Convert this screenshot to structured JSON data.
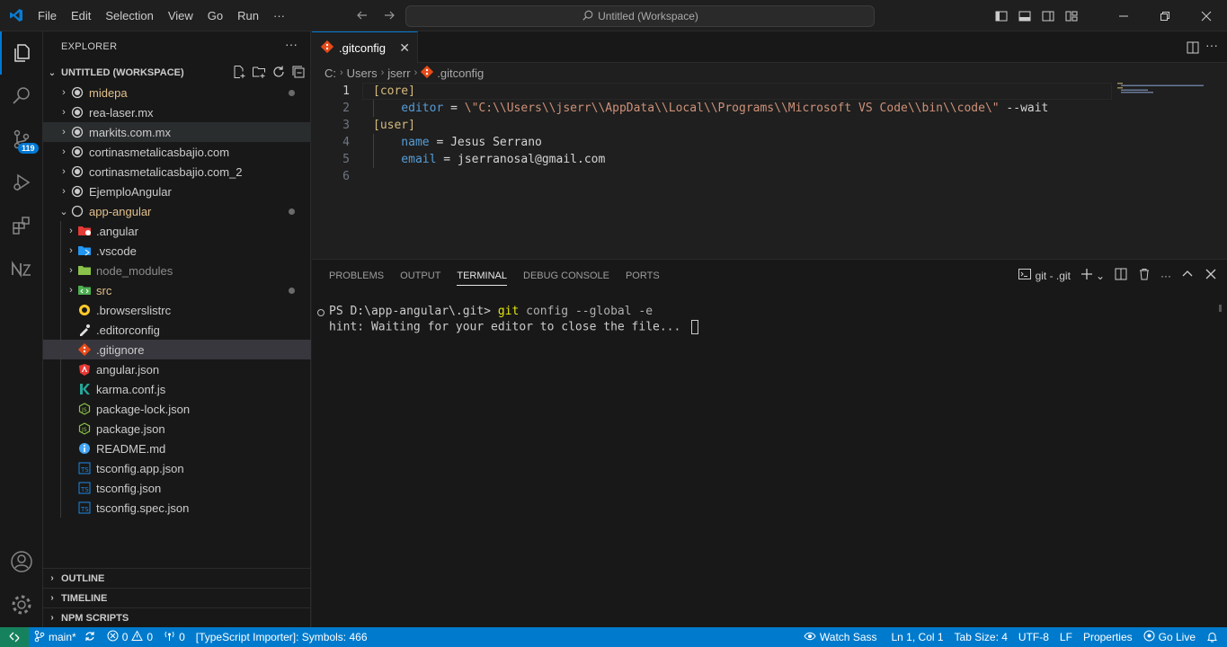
{
  "titlebar": {
    "menu": [
      "File",
      "Edit",
      "Selection",
      "View",
      "Go",
      "Run",
      "···"
    ],
    "search_text": "Untitled (Workspace)"
  },
  "activity": {
    "scm_badge": "119"
  },
  "explorer": {
    "title": "EXPLORER",
    "more": "···",
    "workspace": "UNTITLED (WORKSPACE)",
    "items": [
      {
        "label": "midepa",
        "color": "#e2c08d"
      },
      {
        "label": "rea-laser.mx",
        "color": "#cccccc"
      },
      {
        "label": "markits.com.mx",
        "color": "#cccccc"
      },
      {
        "label": "cortinasmetalicasbajio.com",
        "color": "#cccccc"
      },
      {
        "label": "cortinasmetalicasbajio.com_2",
        "color": "#cccccc"
      },
      {
        "label": "EjemploAngular",
        "color": "#cccccc"
      },
      {
        "label": "app-angular",
        "color": "#e2c08d"
      },
      {
        "label": ".angular",
        "color": "#cccccc"
      },
      {
        "label": ".vscode",
        "color": "#cccccc"
      },
      {
        "label": "node_modules",
        "color": "#8c8c8c"
      },
      {
        "label": "src",
        "color": "#e2c08d"
      },
      {
        "label": ".browserslistrc",
        "color": "#cccccc"
      },
      {
        "label": ".editorconfig",
        "color": "#cccccc"
      },
      {
        "label": ".gitignore",
        "color": "#cccccc"
      },
      {
        "label": "angular.json",
        "color": "#cccccc"
      },
      {
        "label": "karma.conf.js",
        "color": "#cccccc"
      },
      {
        "label": "package-lock.json",
        "color": "#cccccc"
      },
      {
        "label": "package.json",
        "color": "#cccccc"
      },
      {
        "label": "README.md",
        "color": "#cccccc"
      },
      {
        "label": "tsconfig.app.json",
        "color": "#cccccc"
      },
      {
        "label": "tsconfig.json",
        "color": "#cccccc"
      },
      {
        "label": "tsconfig.spec.json",
        "color": "#cccccc"
      }
    ],
    "sections": [
      "OUTLINE",
      "TIMELINE",
      "NPM SCRIPTS"
    ]
  },
  "editor": {
    "tab": ".gitconfig",
    "breadcrumb": [
      "C:",
      "Users",
      "jserr",
      ".gitconfig"
    ],
    "lines": [
      {
        "n": "1",
        "parts": [
          {
            "t": "[core]",
            "c": "#d7ba7d"
          }
        ]
      },
      {
        "n": "2",
        "parts": [
          {
            "t": "    editor",
            "c": "#569cd6"
          },
          {
            "t": " = ",
            "c": "#d4d4d4"
          },
          {
            "t": "\\\"C:\\\\Users\\\\jserr\\\\AppData\\\\Local\\\\Programs\\\\Microsoft VS Code\\\\bin\\\\code\\\"",
            "c": "#ce9178"
          },
          {
            "t": " --wait",
            "c": "#d4d4d4"
          }
        ]
      },
      {
        "n": "3",
        "parts": [
          {
            "t": "[user]",
            "c": "#d7ba7d"
          }
        ]
      },
      {
        "n": "4",
        "parts": [
          {
            "t": "    name",
            "c": "#569cd6"
          },
          {
            "t": " = Jesus Serrano",
            "c": "#d4d4d4"
          }
        ]
      },
      {
        "n": "5",
        "parts": [
          {
            "t": "    email",
            "c": "#569cd6"
          },
          {
            "t": " = jserranosal@gmail.com",
            "c": "#d4d4d4"
          }
        ]
      },
      {
        "n": "6",
        "parts": []
      }
    ]
  },
  "panel": {
    "tabs": [
      "PROBLEMS",
      "OUTPUT",
      "TERMINAL",
      "DEBUG CONSOLE",
      "PORTS"
    ],
    "terminal_name": "git - .git",
    "prompt": "PS D:\\app-angular\\.git> ",
    "cmd": "git",
    "args": " config --global -e",
    "hint": "hint: Waiting for your editor to close the file... "
  },
  "status": {
    "branch": "main*",
    "errors": "0",
    "warnings": "0",
    "ports": "0",
    "ts": "[TypeScript Importer]: Symbols: 466",
    "watch_sass": "Watch Sass",
    "position": "Ln 1, Col 1",
    "tab_size": "Tab Size: 4",
    "encoding": "UTF-8",
    "eol": "LF",
    "properties": "Properties",
    "go_live": "Go Live"
  }
}
